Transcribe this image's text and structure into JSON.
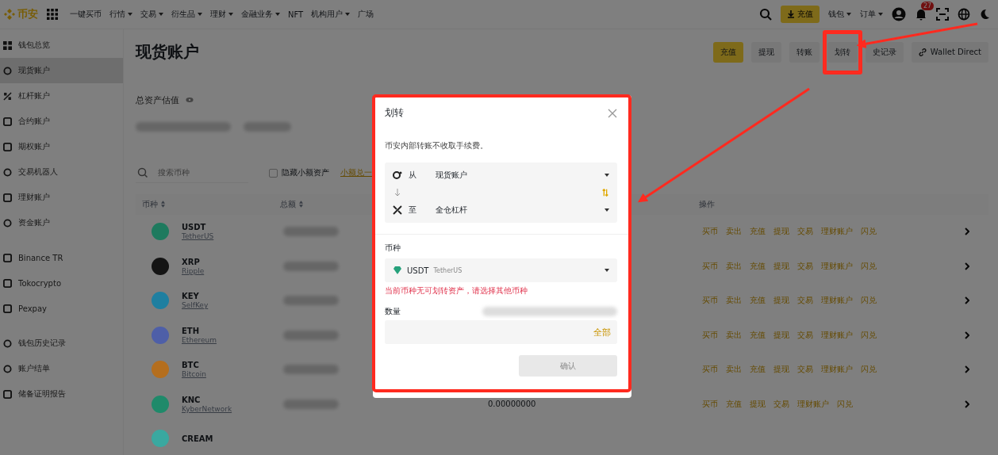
{
  "nav": {
    "logo": "币安",
    "menu": [
      {
        "label": "一键买币",
        "dropdown": false
      },
      {
        "label": "行情",
        "dropdown": true
      },
      {
        "label": "交易",
        "dropdown": true
      },
      {
        "label": "衍生品",
        "dropdown": true
      },
      {
        "label": "理财",
        "dropdown": true
      },
      {
        "label": "金融业务",
        "dropdown": true
      },
      {
        "label": "NFT",
        "dropdown": false
      },
      {
        "label": "机构用户",
        "dropdown": true
      },
      {
        "label": "广场",
        "dropdown": false
      }
    ],
    "deposit_button": "充值",
    "right_menu": [
      {
        "label": "钱包",
        "dropdown": true
      },
      {
        "label": "订单",
        "dropdown": true
      }
    ],
    "notification_badge": "27"
  },
  "sidebar": {
    "groups": [
      [
        {
          "label": "钱包总览",
          "selected": false
        },
        {
          "label": "现货账户",
          "selected": true
        },
        {
          "label": "杠杆账户",
          "selected": false
        },
        {
          "label": "合约账户",
          "selected": false
        },
        {
          "label": "期权账户",
          "selected": false
        },
        {
          "label": "交易机器人",
          "selected": false
        },
        {
          "label": "理财账户",
          "selected": false
        },
        {
          "label": "资金账户",
          "selected": false
        }
      ],
      [
        {
          "label": "Binance TR",
          "selected": false
        },
        {
          "label": "Tokocrypto",
          "selected": false
        },
        {
          "label": "Pexpay",
          "selected": false
        }
      ],
      [
        {
          "label": "钱包历史记录",
          "selected": false
        },
        {
          "label": "账户结单",
          "selected": false
        },
        {
          "label": "储备证明报告",
          "selected": false
        }
      ]
    ]
  },
  "page": {
    "title": "现货账户",
    "actions": [
      {
        "label": "充值",
        "primary": true,
        "highlighted": false
      },
      {
        "label": "提现",
        "primary": false,
        "highlighted": false
      },
      {
        "label": "转账",
        "primary": false,
        "highlighted": false
      },
      {
        "label": "划转",
        "primary": false,
        "highlighted": true
      },
      {
        "label": "史记录",
        "primary": false,
        "highlighted": false
      },
      {
        "label": "Wallet Direct",
        "primary": false,
        "highlighted": false
      }
    ],
    "balance_label": "总资产估值",
    "search": {
      "placeholder": "搜索币种"
    },
    "hide_small": {
      "label": "隐藏小额资产",
      "checked": false
    },
    "small_link": "小额兑一",
    "table": {
      "columns": [
        "币种",
        "总额",
        "操作"
      ],
      "rows": [
        {
          "symbol": "USDT",
          "name": "TetherUS",
          "color": "#1e7a5e",
          "value": "",
          "actions": [
            "买币",
            "卖出",
            "充值",
            "提现",
            "交易",
            "理财账户",
            "闪兑"
          ]
        },
        {
          "symbol": "XRP",
          "name": "Ripple",
          "color": "#141414",
          "value": "",
          "actions": [
            "买币",
            "卖出",
            "充值",
            "提现",
            "交易",
            "理财账户",
            "闪兑"
          ]
        },
        {
          "symbol": "KEY",
          "name": "SelfKey",
          "color": "#1f7fa0",
          "value": "",
          "actions": [
            "买币",
            "卖出",
            "充值",
            "提现",
            "交易",
            "理财账户",
            "闪兑"
          ]
        },
        {
          "symbol": "ETH",
          "name": "Ethereum",
          "color": "#4e5fa8",
          "value": "",
          "actions": [
            "买币",
            "卖出",
            "充值",
            "提现",
            "交易",
            "理财账户",
            "闪兑"
          ]
        },
        {
          "symbol": "BTC",
          "name": "Bitcoin",
          "color": "#b46e1e",
          "value": "",
          "actions": [
            "买币",
            "卖出",
            "充值",
            "提现",
            "交易",
            "理财账户",
            "闪兑"
          ]
        },
        {
          "symbol": "KNC",
          "name": "KyberNetwork",
          "color": "#1f8a6a",
          "value": "0.00000000",
          "actions": [
            "买币",
            "充值",
            "提现",
            "交易",
            "理财账户",
            "闪兑"
          ]
        },
        {
          "symbol": "CREAM",
          "name": "",
          "color": "#3aa8a0",
          "value": "",
          "actions": []
        }
      ]
    }
  },
  "modal": {
    "title": "划转",
    "note": "币安内部转账不收取手续费。",
    "from_label": "从",
    "from_value": "现货账户",
    "to_label": "至",
    "to_value": "全仓杠杆",
    "coin_label": "币种",
    "coin_symbol": "USDT",
    "coin_name": "TetherUS",
    "error": "当前币种无可划转资产，请选择其他币种",
    "amount_label": "数量",
    "max_link": "全部",
    "confirm": {
      "label": "确认",
      "disabled": true
    }
  }
}
